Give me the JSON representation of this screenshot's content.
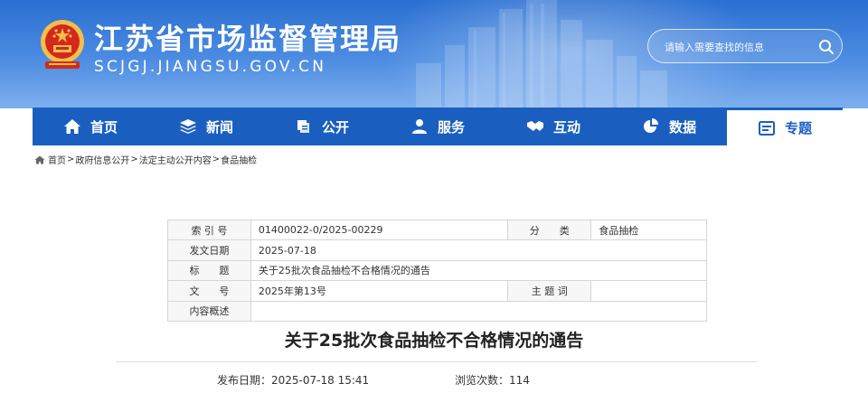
{
  "header": {
    "site_title": "江苏省市场监督管理局",
    "site_domain": "SCJGJ.JIANGSU.GOV.CN",
    "search_placeholder": "请输入需要查找的信息"
  },
  "nav": {
    "items": [
      {
        "label": "首页",
        "icon": "home-icon"
      },
      {
        "label": "新闻",
        "icon": "layers-icon"
      },
      {
        "label": "公开",
        "icon": "book-icon"
      },
      {
        "label": "服务",
        "icon": "people-icon"
      },
      {
        "label": "互动",
        "icon": "handshake-icon"
      },
      {
        "label": "数据",
        "icon": "pie-chart-icon"
      },
      {
        "label": "专题",
        "icon": "topic-icon",
        "active": true
      }
    ]
  },
  "breadcrumb": [
    "首页",
    "政府信息公开",
    "法定主动公开内容",
    "食品抽检"
  ],
  "info_table": {
    "index_label": "索 引 号",
    "index_value": "01400022-0/2025-00229",
    "category_label": "分　　类",
    "category_value": "食品抽检",
    "date_label": "发文日期",
    "date_value": "2025-07-18",
    "title_label": "标　　题",
    "title_value": "关于25批次食品抽检不合格情况的通告",
    "docnum_label": "文　　号",
    "docnum_value": "2025年第13号",
    "subject_label": "主 题 词",
    "subject_value": "",
    "summary_label": "内容概述",
    "summary_value": ""
  },
  "article": {
    "title": "关于25批次食品抽检不合格情况的通告",
    "publish_label": "发布日期：",
    "publish_value": "2025-07-18 15:41",
    "views_label": "浏览次数：",
    "views_value": "114"
  },
  "colors": {
    "header_blue": "#2a6fd1",
    "nav_blue": "#1a5fc0",
    "emblem_red": "#d4281c",
    "emblem_gold": "#f2c04a"
  }
}
